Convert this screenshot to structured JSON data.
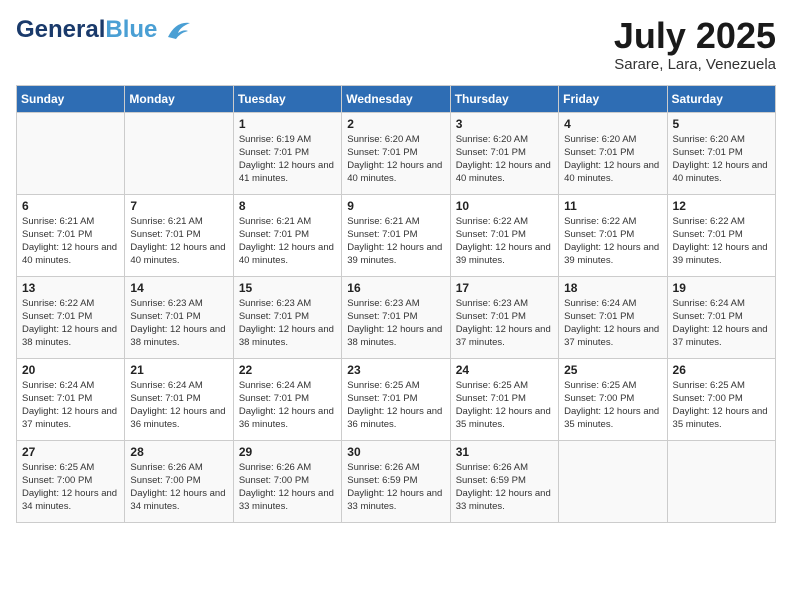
{
  "header": {
    "logo_general": "General",
    "logo_blue": "Blue",
    "month_year": "July 2025",
    "location": "Sarare, Lara, Venezuela"
  },
  "days_of_week": [
    "Sunday",
    "Monday",
    "Tuesday",
    "Wednesday",
    "Thursday",
    "Friday",
    "Saturday"
  ],
  "weeks": [
    [
      {
        "day": "",
        "info": ""
      },
      {
        "day": "",
        "info": ""
      },
      {
        "day": "1",
        "info": "Sunrise: 6:19 AM\nSunset: 7:01 PM\nDaylight: 12 hours and 41 minutes."
      },
      {
        "day": "2",
        "info": "Sunrise: 6:20 AM\nSunset: 7:01 PM\nDaylight: 12 hours and 40 minutes."
      },
      {
        "day": "3",
        "info": "Sunrise: 6:20 AM\nSunset: 7:01 PM\nDaylight: 12 hours and 40 minutes."
      },
      {
        "day": "4",
        "info": "Sunrise: 6:20 AM\nSunset: 7:01 PM\nDaylight: 12 hours and 40 minutes."
      },
      {
        "day": "5",
        "info": "Sunrise: 6:20 AM\nSunset: 7:01 PM\nDaylight: 12 hours and 40 minutes."
      }
    ],
    [
      {
        "day": "6",
        "info": "Sunrise: 6:21 AM\nSunset: 7:01 PM\nDaylight: 12 hours and 40 minutes."
      },
      {
        "day": "7",
        "info": "Sunrise: 6:21 AM\nSunset: 7:01 PM\nDaylight: 12 hours and 40 minutes."
      },
      {
        "day": "8",
        "info": "Sunrise: 6:21 AM\nSunset: 7:01 PM\nDaylight: 12 hours and 40 minutes."
      },
      {
        "day": "9",
        "info": "Sunrise: 6:21 AM\nSunset: 7:01 PM\nDaylight: 12 hours and 39 minutes."
      },
      {
        "day": "10",
        "info": "Sunrise: 6:22 AM\nSunset: 7:01 PM\nDaylight: 12 hours and 39 minutes."
      },
      {
        "day": "11",
        "info": "Sunrise: 6:22 AM\nSunset: 7:01 PM\nDaylight: 12 hours and 39 minutes."
      },
      {
        "day": "12",
        "info": "Sunrise: 6:22 AM\nSunset: 7:01 PM\nDaylight: 12 hours and 39 minutes."
      }
    ],
    [
      {
        "day": "13",
        "info": "Sunrise: 6:22 AM\nSunset: 7:01 PM\nDaylight: 12 hours and 38 minutes."
      },
      {
        "day": "14",
        "info": "Sunrise: 6:23 AM\nSunset: 7:01 PM\nDaylight: 12 hours and 38 minutes."
      },
      {
        "day": "15",
        "info": "Sunrise: 6:23 AM\nSunset: 7:01 PM\nDaylight: 12 hours and 38 minutes."
      },
      {
        "day": "16",
        "info": "Sunrise: 6:23 AM\nSunset: 7:01 PM\nDaylight: 12 hours and 38 minutes."
      },
      {
        "day": "17",
        "info": "Sunrise: 6:23 AM\nSunset: 7:01 PM\nDaylight: 12 hours and 37 minutes."
      },
      {
        "day": "18",
        "info": "Sunrise: 6:24 AM\nSunset: 7:01 PM\nDaylight: 12 hours and 37 minutes."
      },
      {
        "day": "19",
        "info": "Sunrise: 6:24 AM\nSunset: 7:01 PM\nDaylight: 12 hours and 37 minutes."
      }
    ],
    [
      {
        "day": "20",
        "info": "Sunrise: 6:24 AM\nSunset: 7:01 PM\nDaylight: 12 hours and 37 minutes."
      },
      {
        "day": "21",
        "info": "Sunrise: 6:24 AM\nSunset: 7:01 PM\nDaylight: 12 hours and 36 minutes."
      },
      {
        "day": "22",
        "info": "Sunrise: 6:24 AM\nSunset: 7:01 PM\nDaylight: 12 hours and 36 minutes."
      },
      {
        "day": "23",
        "info": "Sunrise: 6:25 AM\nSunset: 7:01 PM\nDaylight: 12 hours and 36 minutes."
      },
      {
        "day": "24",
        "info": "Sunrise: 6:25 AM\nSunset: 7:01 PM\nDaylight: 12 hours and 35 minutes."
      },
      {
        "day": "25",
        "info": "Sunrise: 6:25 AM\nSunset: 7:00 PM\nDaylight: 12 hours and 35 minutes."
      },
      {
        "day": "26",
        "info": "Sunrise: 6:25 AM\nSunset: 7:00 PM\nDaylight: 12 hours and 35 minutes."
      }
    ],
    [
      {
        "day": "27",
        "info": "Sunrise: 6:25 AM\nSunset: 7:00 PM\nDaylight: 12 hours and 34 minutes."
      },
      {
        "day": "28",
        "info": "Sunrise: 6:26 AM\nSunset: 7:00 PM\nDaylight: 12 hours and 34 minutes."
      },
      {
        "day": "29",
        "info": "Sunrise: 6:26 AM\nSunset: 7:00 PM\nDaylight: 12 hours and 33 minutes."
      },
      {
        "day": "30",
        "info": "Sunrise: 6:26 AM\nSunset: 6:59 PM\nDaylight: 12 hours and 33 minutes."
      },
      {
        "day": "31",
        "info": "Sunrise: 6:26 AM\nSunset: 6:59 PM\nDaylight: 12 hours and 33 minutes."
      },
      {
        "day": "",
        "info": ""
      },
      {
        "day": "",
        "info": ""
      }
    ]
  ]
}
